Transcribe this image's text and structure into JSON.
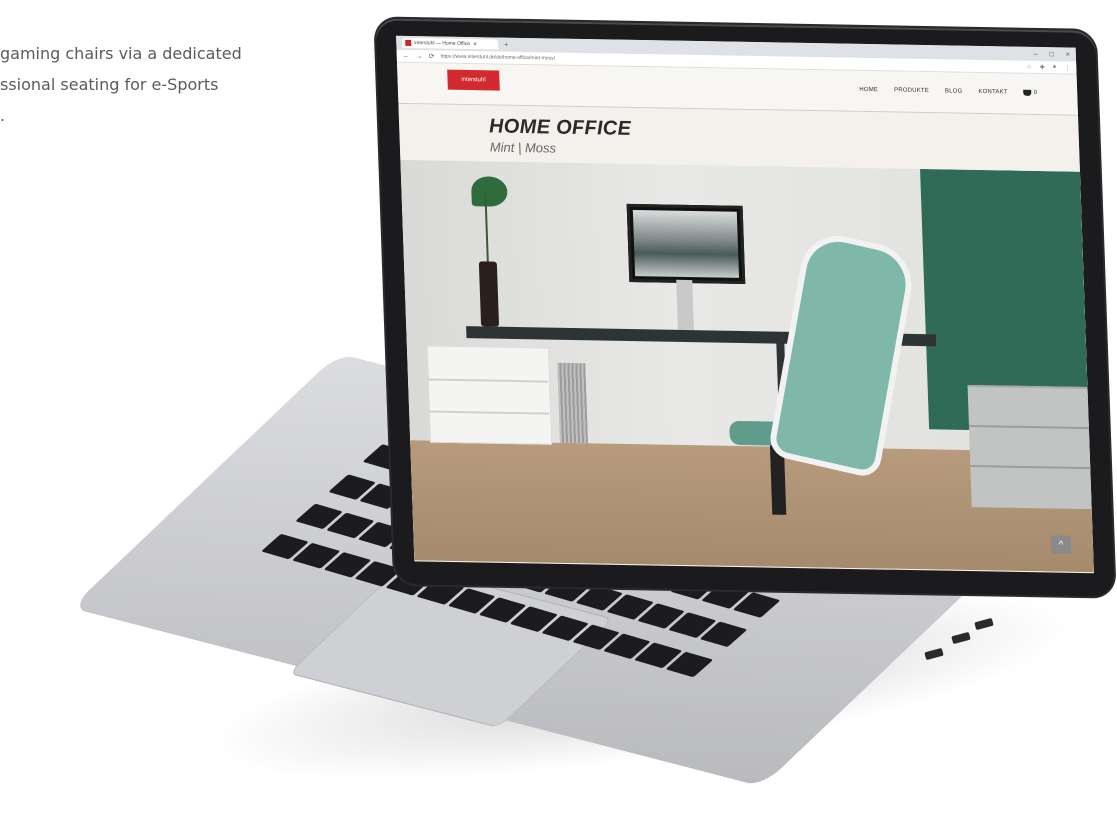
{
  "side_text": {
    "lines": [
      "gaming chairs via a dedicated",
      "ssional seating for e-Sports",
      "."
    ]
  },
  "browser": {
    "tab_title": "interstuhl — Home Office",
    "tab_close": "×",
    "new_tab": "+",
    "window_controls": [
      "–",
      "□",
      "×"
    ],
    "nav_back": "←",
    "nav_forward": "→",
    "nav_reload": "⟳",
    "url": "https://www.interstuhl.de/de/home-office/mint-moss/"
  },
  "site": {
    "logo": "interstuhl",
    "nav": [
      "HOME",
      "PRODUKTE",
      "BLOG",
      "KONTAKT"
    ],
    "cart_count": "0",
    "hero": {
      "title": "HOME OFFICE",
      "subtitle": "Mint | Moss"
    },
    "scroll_top_icon": "^"
  },
  "colors": {
    "brand": "#d32a2f",
    "accent_green": "#2f6b57"
  }
}
